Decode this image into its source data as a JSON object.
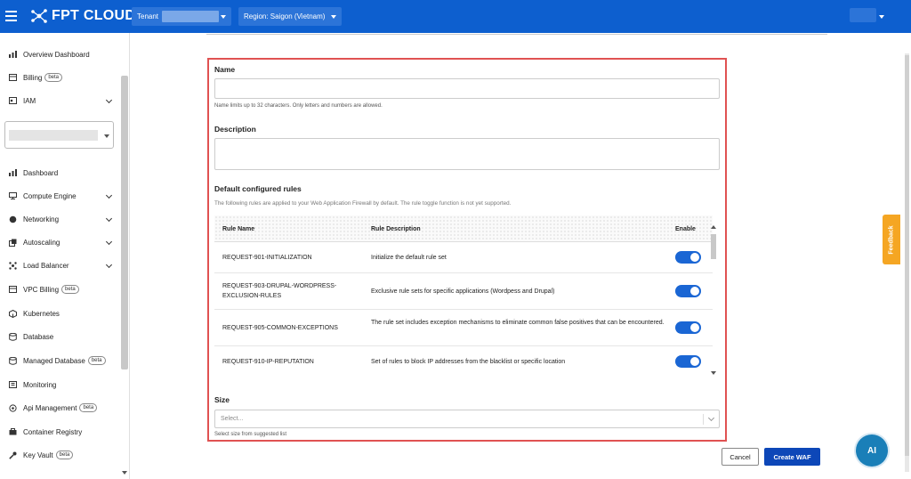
{
  "header": {
    "brand": "FPT CLOUD",
    "tenant_label": "Tenant",
    "region_label": "Region: Saigon (Vietnam)"
  },
  "sidebar": {
    "top_items": [
      {
        "label": "Overview Dashboard",
        "icon": "bar-chart-icon"
      },
      {
        "label": "Billing",
        "badge": "beta",
        "icon": "receipt-icon"
      },
      {
        "label": "IAM",
        "icon": "id-card-icon"
      }
    ],
    "items": [
      {
        "label": "Dashboard",
        "icon": "bar-chart-icon"
      },
      {
        "label": "Compute Engine",
        "icon": "monitor-icon"
      },
      {
        "label": "Networking",
        "icon": "globe-icon"
      },
      {
        "label": "Autoscaling",
        "icon": "scaling-icon"
      },
      {
        "label": "Load Balancer",
        "icon": "load-balancer-icon"
      },
      {
        "label": "VPC Billing",
        "badge": "beta",
        "icon": "receipt-icon"
      },
      {
        "label": "Kubernetes",
        "icon": "cube-icon"
      },
      {
        "label": "Database",
        "icon": "database-icon"
      },
      {
        "label": "Managed Database",
        "badge": "beta",
        "icon": "database-icon"
      },
      {
        "label": "Monitoring",
        "icon": "monitor-chart-icon"
      },
      {
        "label": "Api Management",
        "badge": "beta",
        "icon": "api-icon"
      },
      {
        "label": "Container Registry",
        "icon": "container-icon"
      },
      {
        "label": "Key Vault",
        "badge": "beta",
        "icon": "key-icon"
      }
    ]
  },
  "form": {
    "name_label": "Name",
    "name_hint": "Name limits up to 32 characters. Only letters and numbers are allowed.",
    "description_label": "Description",
    "rules_label": "Default configured rules",
    "rules_hint": "The following rules are applied to your Web Application Firewall by default. The rule toggle function is not yet supported.",
    "columns": {
      "name": "Rule Name",
      "desc": "Rule Description",
      "enable": "Enable"
    },
    "rules": [
      {
        "name": "REQUEST-901-INITIALIZATION",
        "desc": "Initialize the default rule set",
        "enabled": true
      },
      {
        "name": "REQUEST-903-DRUPAL-WORDPRESS-EXCLUSION-RULES",
        "desc": "Exclusive rule sets for specific applications (Wordpess and Drupal)",
        "enabled": true
      },
      {
        "name": "REQUEST-905-COMMON-EXCEPTIONS",
        "desc": "The rule set includes exception mechanisms to eliminate common false positives that can be encountered.",
        "enabled": true
      },
      {
        "name": "REQUEST-910-IP-REPUTATION",
        "desc": "Set of rules to block IP addresses from the blacklist or specific location",
        "enabled": true
      }
    ],
    "size_label": "Size",
    "size_placeholder": "Select...",
    "size_hint": "Select size from suggested list"
  },
  "actions": {
    "cancel": "Cancel",
    "create": "Create WAF"
  },
  "feedback": "Feedback",
  "assistant": "AI",
  "colors": {
    "brand": "#0d5fcf",
    "primary_button": "#0d47b8",
    "toggle": "#1a66d4",
    "highlight_border": "#e05252",
    "feedback": "#f5a623"
  }
}
